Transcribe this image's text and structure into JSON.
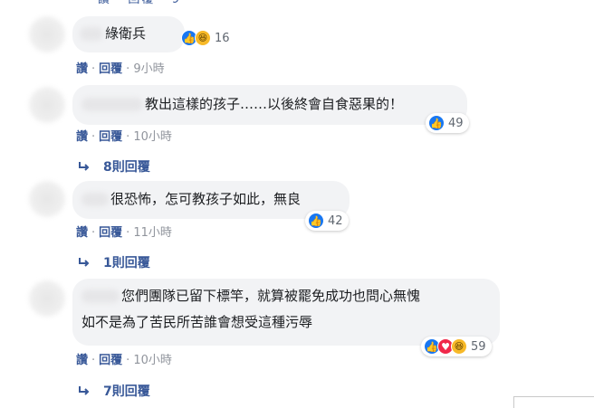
{
  "comments": [
    {
      "text": "綠衛兵",
      "reactions": {
        "icons": [
          "like",
          "haha"
        ],
        "count": "16"
      },
      "actions": {
        "like": "讚",
        "reply": "回覆",
        "time": "9小時"
      }
    },
    {
      "text": "教出這樣的孩子……以後終會自食惡果的！",
      "reactions": {
        "icons": [
          "like"
        ],
        "count": "49"
      },
      "actions": {
        "like": "讚",
        "reply": "回覆",
        "time": "10小時"
      },
      "replies": "8則回覆"
    },
    {
      "text": "很恐怖，怎可教孩子如此，無良",
      "reactions": {
        "icons": [
          "like"
        ],
        "count": "42"
      },
      "actions": {
        "like": "讚",
        "reply": "回覆",
        "time": "11小時"
      },
      "replies": "1則回覆"
    },
    {
      "text_line1": "您們團隊已留下標竿，就算被罷免成功也問心無愧",
      "text_line2": "如不是為了苦民所苦誰會想受這種污辱",
      "reactions": {
        "icons": [
          "like",
          "love",
          "haha"
        ],
        "count": "59"
      },
      "actions": {
        "like": "讚",
        "reply": "回覆",
        "time": "10小時"
      },
      "replies": "7則回覆"
    }
  ]
}
